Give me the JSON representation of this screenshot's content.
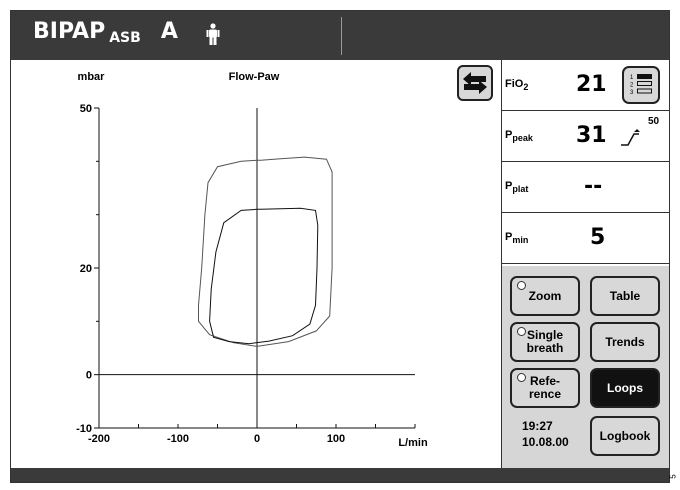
{
  "header": {
    "mode": "BIPAP",
    "mode_sub": "ASB",
    "patient_mode": "A"
  },
  "chart_data": {
    "type": "loop",
    "title": "Flow-Paw",
    "ylabel": "mbar",
    "xlabel": "L/min",
    "xlim": [
      -200,
      200
    ],
    "ylim": [
      -10,
      50
    ],
    "x_ticks": [
      "-200",
      "-100",
      "0",
      "100"
    ],
    "y_ticks": [
      "50",
      "20",
      "0",
      "-10"
    ],
    "series": [
      {
        "values": [
          [
            0,
            40.2
          ],
          [
            -20,
            40.0
          ],
          [
            -50,
            39.0
          ],
          [
            -62,
            36
          ],
          [
            -66,
            30
          ],
          [
            -70,
            20
          ],
          [
            -74,
            13
          ],
          [
            -74,
            10
          ],
          [
            -60,
            7.5
          ],
          [
            -30,
            6.0
          ],
          [
            0,
            5.3
          ],
          [
            40,
            6.2
          ],
          [
            75,
            8.2
          ],
          [
            92,
            11
          ],
          [
            95,
            20
          ],
          [
            95,
            30
          ],
          [
            95,
            38
          ],
          [
            88,
            40.4
          ],
          [
            60,
            40.8
          ],
          [
            30,
            40.5
          ],
          [
            5,
            40.2
          ]
        ]
      },
      {
        "values": [
          [
            0,
            31.0
          ],
          [
            -20,
            30.8
          ],
          [
            -42,
            28.5
          ],
          [
            -52,
            23
          ],
          [
            -58,
            16
          ],
          [
            -60,
            10
          ],
          [
            -55,
            7.0
          ],
          [
            -35,
            6.2
          ],
          [
            -10,
            5.8
          ],
          [
            15,
            6.3
          ],
          [
            45,
            7.3
          ],
          [
            67,
            9.5
          ],
          [
            74,
            13
          ],
          [
            76,
            20
          ],
          [
            77,
            28
          ],
          [
            74,
            30.8
          ],
          [
            55,
            31.2
          ],
          [
            30,
            31.1
          ],
          [
            5,
            31.0
          ]
        ]
      }
    ]
  },
  "params": [
    {
      "label": "FiO",
      "sub": "2",
      "value": "21"
    },
    {
      "label": "P",
      "sub": "peak",
      "value": "31",
      "limit": "50"
    },
    {
      "label": "P",
      "sub": "plat",
      "value": "--"
    },
    {
      "label": "P",
      "sub": "min",
      "value": "5"
    }
  ],
  "buttons": {
    "zoom": "Zoom",
    "table": "Table",
    "single_breath": "Single\nbreath",
    "trends": "Trends",
    "reference": "Refe-\nrence",
    "loops": "Loops",
    "logbook": "Logbook"
  },
  "status": {
    "time": "19:27",
    "date": "10.08.00"
  },
  "side_number": "5"
}
